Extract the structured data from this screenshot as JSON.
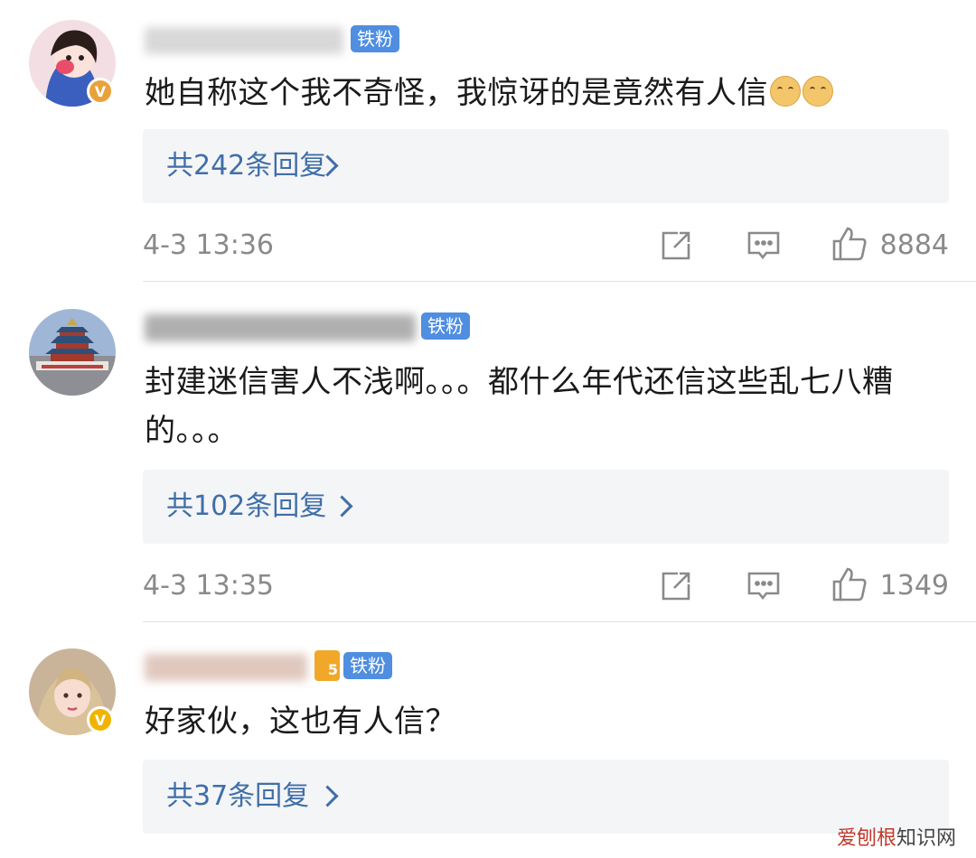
{
  "comments": [
    {
      "text": "她自称这个我不奇怪，我惊讶的是竟然有人信",
      "emojis": [
        "doge-icon",
        "doge-icon"
      ],
      "badge": "铁粉",
      "verified_color": "#e8a23a",
      "replies_label": "共242条回复",
      "time": "4-3 13:36",
      "likes": "8884"
    },
    {
      "text": "封建迷信害人不浅啊。。。都什么年代还信这些乱七八糟的。。。",
      "badge": "铁粉",
      "replies_label": "共102条回复",
      "time": "4-3 13:35",
      "likes": "1349"
    },
    {
      "text": "好家伙，这也有人信？",
      "badge": "铁粉",
      "level_badge": "5",
      "verified_color": "#f0b400",
      "replies_label": "共37条回复"
    }
  ],
  "icons": {
    "share": "share-icon",
    "comment": "comment-icon",
    "like": "thumbs-up-icon"
  },
  "colors": {
    "fan_badge": "#4f8ee0",
    "reply_link": "#3f6ea8",
    "reply_bg": "#f4f5f7"
  },
  "watermark": {
    "text_red": "爱刨根",
    "text": "知识网"
  }
}
